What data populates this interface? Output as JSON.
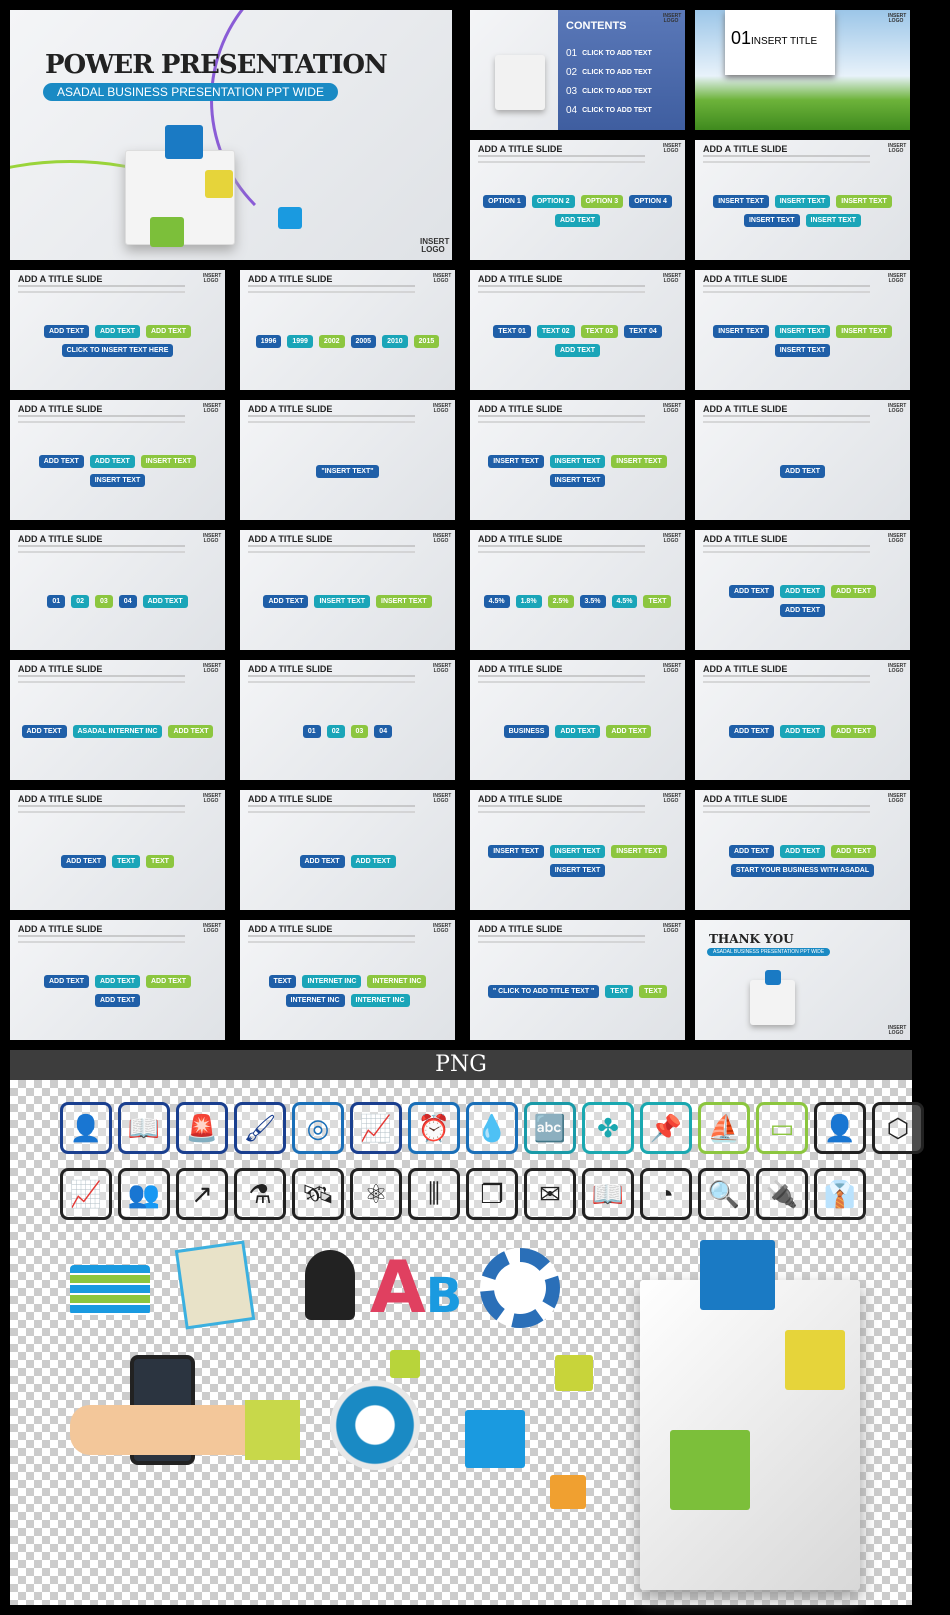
{
  "hero": {
    "title": "POWER PRESENTATION",
    "subtitle": "ASADAL BUSINESS PRESENTATION PPT WIDE",
    "logo": "INSERT LOGO"
  },
  "contents": {
    "title": "CONTENTS",
    "items": [
      {
        "num": "01",
        "label": "CLICK TO ADD TEXT"
      },
      {
        "num": "02",
        "label": "CLICK TO ADD TEXT"
      },
      {
        "num": "03",
        "label": "CLICK TO ADD TEXT"
      },
      {
        "num": "04",
        "label": "CLICK TO ADD TEXT"
      }
    ],
    "logo": "INSERT LOGO"
  },
  "section": {
    "num": "01",
    "title": "INSERT TITLE",
    "logo": "INSERT LOGO"
  },
  "slide_title": "ADD A TITLE SLIDE",
  "logo": "INSERT LOGO",
  "slides": [
    [
      "OPTION 1",
      "OPTION 2",
      "OPTION 3",
      "OPTION 4",
      "ADD TEXT"
    ],
    [
      "INSERT TEXT",
      "INSERT TEXT",
      "INSERT TEXT",
      "INSERT TEXT",
      "INSERT TEXT"
    ],
    [
      "ADD TEXT",
      "ADD TEXT",
      "ADD TEXT",
      "CLICK TO INSERT TEXT HERE"
    ],
    [
      "1996",
      "1999",
      "2002",
      "2005",
      "2010",
      "2015"
    ],
    [
      "TEXT 01",
      "TEXT 02",
      "TEXT 03",
      "TEXT 04",
      "ADD TEXT"
    ],
    [
      "INSERT TEXT",
      "INSERT TEXT",
      "INSERT TEXT",
      "INSERT TEXT"
    ],
    [
      "ADD TEXT",
      "ADD TEXT",
      "INSERT TEXT",
      "INSERT TEXT"
    ],
    [
      "\"INSERT TEXT\""
    ],
    [
      "INSERT TEXT",
      "INSERT TEXT",
      "INSERT TEXT",
      "INSERT TEXT"
    ],
    [
      "ADD TEXT"
    ],
    [
      "01",
      "02",
      "03",
      "04",
      "ADD TEXT"
    ],
    [
      "ADD TEXT",
      "INSERT TEXT",
      "INSERT TEXT"
    ],
    [
      "4.5%",
      "1.8%",
      "2.5%",
      "3.5%",
      "4.5%",
      "TEXT"
    ],
    [
      "ADD TEXT",
      "ADD TEXT",
      "ADD TEXT",
      "ADD TEXT"
    ],
    [
      "ADD TEXT",
      "ASADAL INTERNET INC",
      "ADD TEXT"
    ],
    [
      "01",
      "02",
      "03",
      "04"
    ],
    [
      "BUSINESS",
      "ADD TEXT",
      "ADD TEXT"
    ],
    [
      "ADD TEXT",
      "ADD TEXT",
      "ADD TEXT"
    ],
    [
      "ADD TEXT",
      "TEXT",
      "TEXT"
    ],
    [
      "ADD TEXT",
      "ADD TEXT"
    ],
    [
      "INSERT TEXT",
      "INSERT TEXT",
      "INSERT TEXT",
      "INSERT TEXT"
    ],
    [
      "ADD TEXT",
      "ADD TEXT",
      "ADD TEXT",
      "START YOUR BUSINESS WITH ASADAL"
    ],
    [
      "ADD TEXT",
      "ADD TEXT",
      "ADD TEXT",
      "ADD TEXT"
    ],
    [
      "TEXT",
      "INTERNET INC",
      "INTERNET INC",
      "INTERNET INC",
      "INTERNET INC"
    ],
    [
      "\" CLICK TO ADD TITLE TEXT \"",
      "TEXT",
      "TEXT"
    ]
  ],
  "thanks": {
    "title": "THANK YOU",
    "subtitle": "ASADAL BUSINESS PRESENTATION PPT WIDE",
    "logo": "INSERT LOGO"
  },
  "png": {
    "header": "PNG",
    "icons_row1": [
      [
        "add-user",
        "#1a3f8f"
      ],
      [
        "book",
        "#1a3f8f"
      ],
      [
        "siren",
        "#1a3f8f"
      ],
      [
        "brush",
        "#1a3f8f"
      ],
      [
        "target",
        "#1a6fb8"
      ],
      [
        "monitor-chart",
        "#1a3f8f"
      ],
      [
        "alarm-clock",
        "#1a6fb8"
      ],
      [
        "drop",
        "#1a6fb8"
      ],
      [
        "abc-blocks",
        "#1a9aa8"
      ],
      [
        "clover",
        "#1aa8b0"
      ],
      [
        "pushpin",
        "#1aa8b0"
      ],
      [
        "paper-boat",
        "#8cc63f"
      ],
      [
        "presentation-board",
        "#8cc63f"
      ],
      [
        "add-user",
        "#222"
      ],
      [
        "3d-cube",
        "#222"
      ]
    ],
    "icons_row2": [
      "monitor-chart",
      "users",
      "growth-arrow",
      "flask",
      "satellite",
      "network",
      "test-tubes",
      "windows",
      "envelope",
      "open-book",
      "pie-chart",
      "search",
      "plug",
      "shirt"
    ],
    "colors": {
      "blue": "#1a3f8f",
      "teal": "#1aa8b0",
      "green": "#8cc63f",
      "cube_blue": "#1a7ac4",
      "cube_yellow": "#e6d43a",
      "cube_green": "#7cbf3a"
    }
  }
}
